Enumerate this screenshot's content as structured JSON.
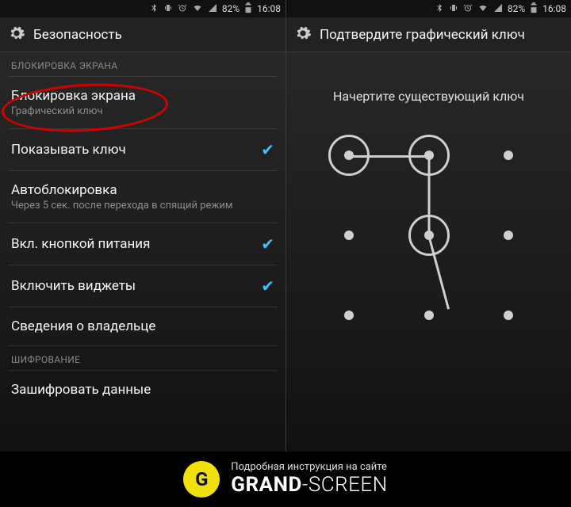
{
  "status": {
    "battery_pct": "82%",
    "time": "16:08"
  },
  "left": {
    "title": "Безопасность",
    "section_lock": "БЛОКИРОВКА ЭКРАНА",
    "section_enc": "ШИФРОВАНИЕ",
    "items": {
      "screen_lock": {
        "title": "Блокировка экрана",
        "sub": "Графический ключ"
      },
      "show_pattern": {
        "title": "Показывать ключ"
      },
      "auto_lock": {
        "title": "Автоблокировка",
        "sub": "Через 5 сек. после перехода в спящий режим"
      },
      "power_lock": {
        "title": "Вкл. кнопкой питания"
      },
      "widgets": {
        "title": "Включить виджеты"
      },
      "owner_info": {
        "title": "Сведения о владельце"
      },
      "encrypt": {
        "title": "Зашифровать данные"
      }
    }
  },
  "right": {
    "title": "Подтвердите графический ключ",
    "prompt": "Начертите существующий ключ"
  },
  "footer": {
    "top": "Подробная инструкция на сайте",
    "brand_bold": "GRAND",
    "brand_thin": "-SCREEN",
    "badge": "G"
  }
}
